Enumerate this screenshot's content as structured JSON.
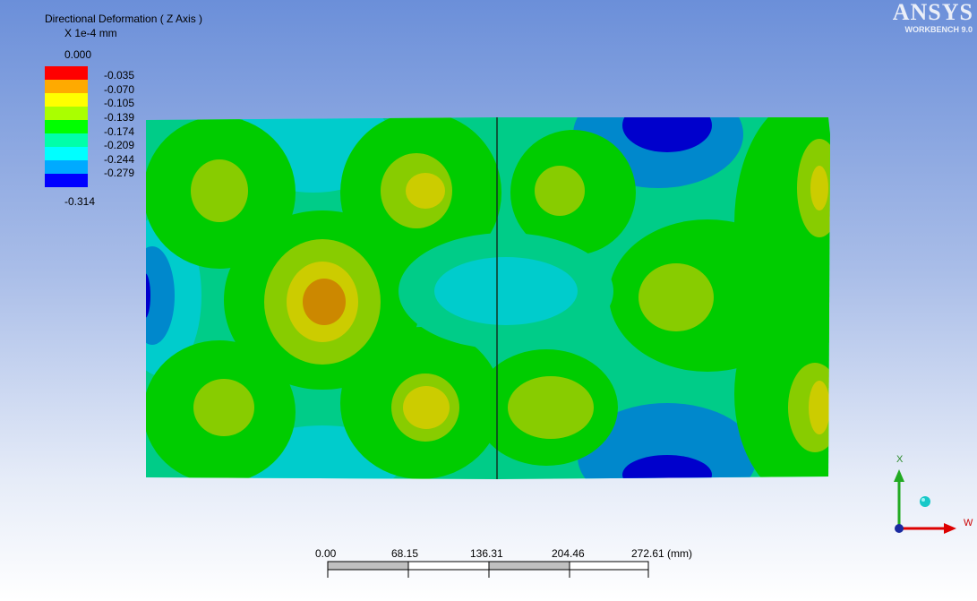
{
  "result": {
    "title": "Directional Deformation ( Z Axis )",
    "units": "X 1e-4 mm"
  },
  "legend": {
    "max_label": "0.000",
    "min_label": "-0.314",
    "bands": [
      {
        "label": "-0.035",
        "color": "#ff0000"
      },
      {
        "label": "-0.070",
        "color": "#ffaa00"
      },
      {
        "label": "-0.105",
        "color": "#ffff00"
      },
      {
        "label": "-0.139",
        "color": "#aaff00"
      },
      {
        "label": "-0.174",
        "color": "#00ff00"
      },
      {
        "label": "-0.209",
        "color": "#00ffaa"
      },
      {
        "label": "-0.244",
        "color": "#00ffff"
      },
      {
        "label": "-0.279",
        "color": "#00aaff"
      },
      {
        "label": "",
        "color": "#0000ff"
      }
    ]
  },
  "logo": {
    "brand": "ANSYS",
    "product": "WORKBENCH 9.0"
  },
  "scale_bar": {
    "ticks": [
      "0.00",
      "68.15",
      "136.31",
      "204.46",
      "272.61 (mm)"
    ]
  },
  "triad": {
    "axis_up": "X",
    "axis_right": "W"
  }
}
